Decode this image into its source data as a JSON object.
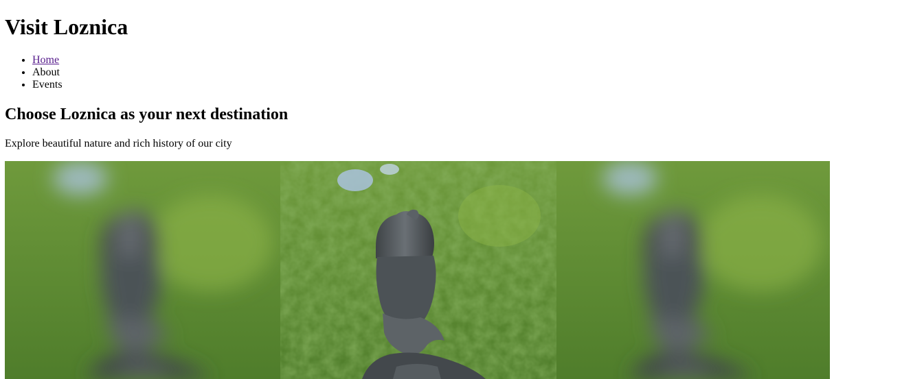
{
  "header": {
    "title": "Visit Loznica"
  },
  "nav": {
    "items": [
      {
        "label": "Home",
        "link": true
      },
      {
        "label": "About",
        "link": false
      },
      {
        "label": "Events",
        "link": false
      }
    ],
    "link_color": "#551a8b"
  },
  "main": {
    "heading": "Choose Loznica as your next destination",
    "tagline": "Explore beautiful nature and rich history of our city"
  },
  "hero": {
    "subject": "statue-photo",
    "colors": {
      "foliage": "#5e8a33",
      "foliage_light": "#8fb548",
      "sky": "#a9c2dd",
      "bronze": "#4d5256"
    }
  }
}
